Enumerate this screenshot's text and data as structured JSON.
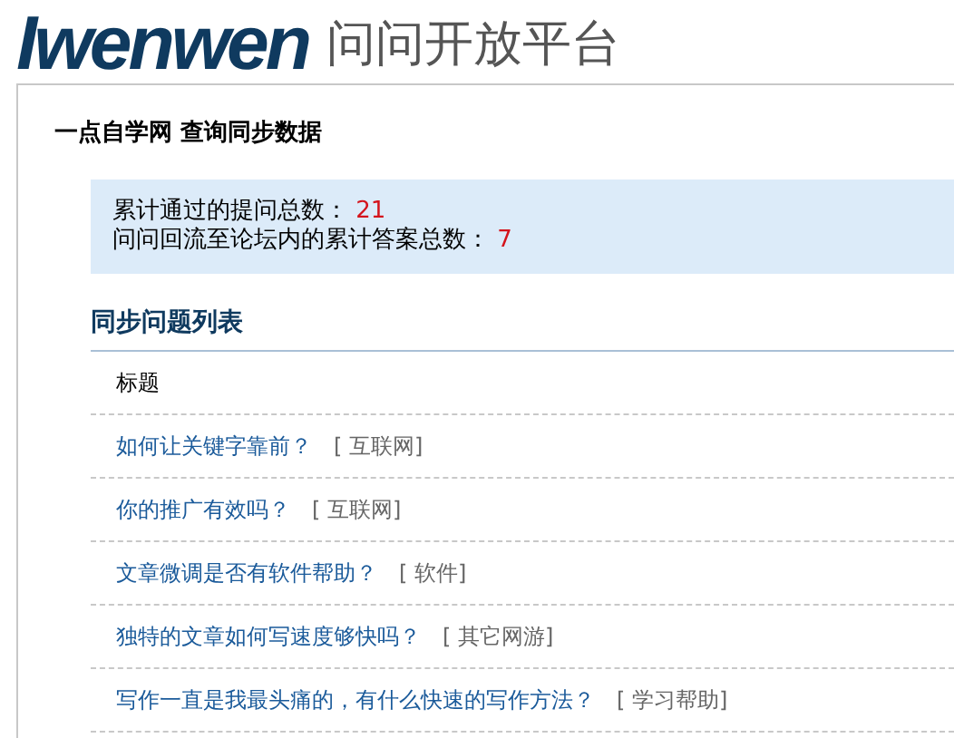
{
  "logo": {
    "brand": "Iwenwen",
    "tagline": "问问开放平台"
  },
  "panel": {
    "title": "一点自学网 查询同步数据",
    "stats": [
      {
        "label": "累计通过的提问总数：",
        "value": "21"
      },
      {
        "label": "问问回流至论坛内的累计答案总数：",
        "value": "7"
      }
    ],
    "section_title": "同步问题列表",
    "table": {
      "columns": [
        "标题"
      ],
      "rows": [
        {
          "question": "如何让关键字靠前？",
          "category": "[ 互联网]"
        },
        {
          "question": "你的推广有效吗？",
          "category": "[ 互联网]"
        },
        {
          "question": "文章微调是否有软件帮助？",
          "category": "[ 软件]"
        },
        {
          "question": "独特的文章如何写速度够快吗？",
          "category": "[ 其它网游]"
        },
        {
          "question": "写作一直是我最头痛的，有什么快速的写作方法？",
          "category": "[ 学习帮助]"
        }
      ]
    }
  }
}
